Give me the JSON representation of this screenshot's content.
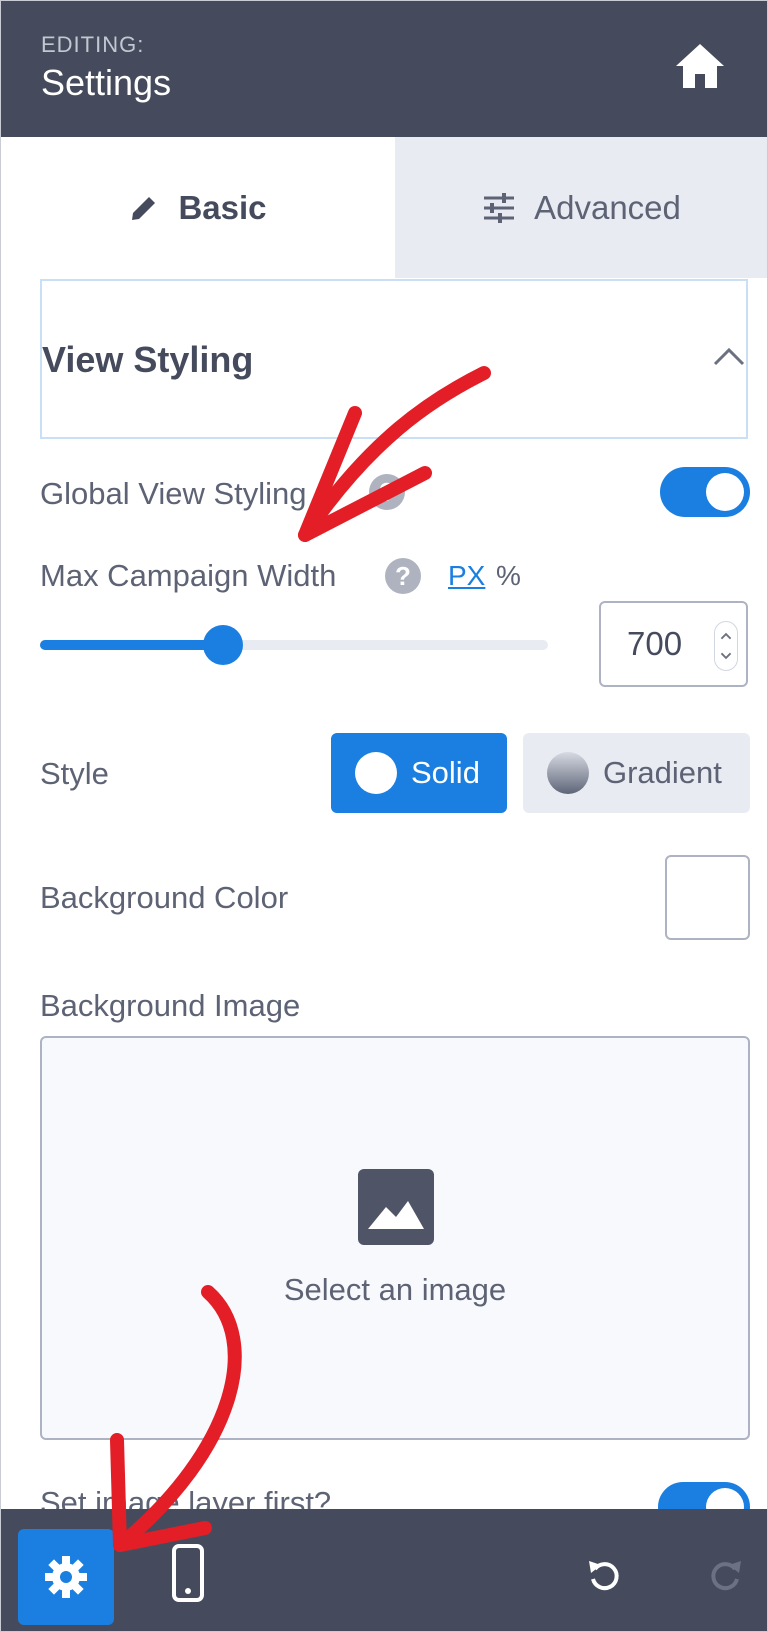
{
  "header": {
    "editing_label": "EDITING:",
    "title": "Settings",
    "home_icon": "home-icon"
  },
  "tabs": [
    {
      "label": "Basic",
      "icon": "pencil-icon",
      "active": true
    },
    {
      "label": "Advanced",
      "icon": "sliders-icon",
      "active": false
    }
  ],
  "section": {
    "title": "View Styling",
    "expanded": true
  },
  "global_view_styling": {
    "label": "Global View Styling",
    "enabled": true
  },
  "max_width": {
    "label": "Max Campaign Width",
    "unit_px": "PX",
    "unit_percent": "%",
    "selected_unit": "PX",
    "value": "700",
    "slider_fraction": 0.36
  },
  "style": {
    "label": "Style",
    "options": [
      "Solid",
      "Gradient"
    ],
    "selected": "Solid"
  },
  "background_color": {
    "label": "Background Color",
    "value": "#ffffff"
  },
  "background_image": {
    "label": "Background Image",
    "placeholder": "Select an image"
  },
  "set_image_layer": {
    "label": "Set image layer first?",
    "enabled": true
  },
  "toolbar": {
    "items": [
      "settings-icon",
      "mobile-icon",
      "undo-icon",
      "redo-icon"
    ],
    "active": "settings-icon"
  },
  "colors": {
    "accent": "#1a7fe0",
    "header_bg": "#454b5c",
    "annotation": "#e41e26"
  }
}
